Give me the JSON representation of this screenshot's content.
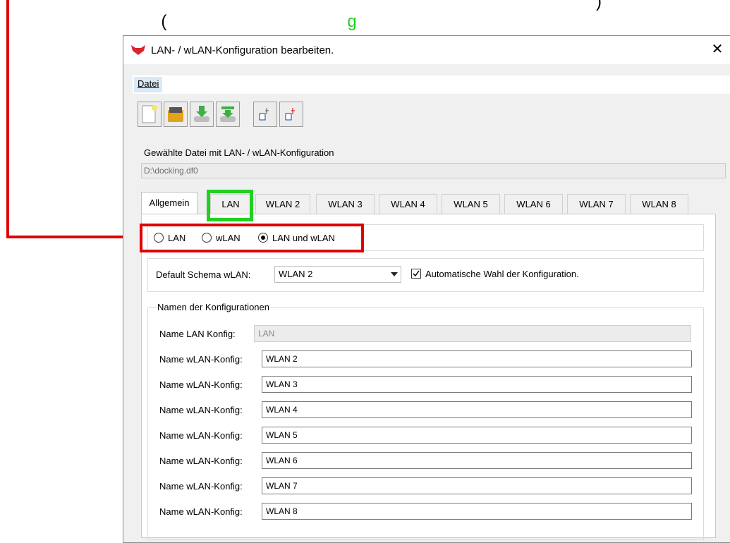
{
  "annotation": {
    "open_paren": "(",
    "green_fragment": "g",
    "close_paren": ")"
  },
  "window": {
    "title": "LAN- / wLAN-Konfiguration bearbeiten.",
    "close_symbol": "✕"
  },
  "menu": {
    "items": [
      {
        "label": "Datei"
      }
    ]
  },
  "toolbar": {
    "buttons": [
      "new-file-icon",
      "open-folder-icon",
      "import-icon",
      "export-icon",
      "device-link-icon",
      "device-send-icon"
    ]
  },
  "file_group": {
    "label": "Gewählte Datei mit LAN- / wLAN-Konfiguration",
    "value": "D:\\docking.df0"
  },
  "tabs": [
    {
      "label": "Allgemein",
      "active": true
    },
    {
      "label": "LAN"
    },
    {
      "label": "WLAN 2"
    },
    {
      "label": "WLAN 3"
    },
    {
      "label": "WLAN 4"
    },
    {
      "label": "WLAN 5"
    },
    {
      "label": "WLAN 6"
    },
    {
      "label": "WLAN 7"
    },
    {
      "label": "WLAN 8"
    }
  ],
  "mode": {
    "options": [
      "LAN",
      "wLAN",
      "LAN und wLAN"
    ],
    "selected": "LAN und wLAN"
  },
  "schema": {
    "label": "Default Schema wLAN:",
    "value": "WLAN 2",
    "auto_label": "Automatische Wahl der Konfiguration.",
    "auto_checked": true
  },
  "names": {
    "label": "Namen der Konfigurationen",
    "lan": {
      "label": "Name LAN Konfig:",
      "value": "LAN"
    },
    "wlan_label": "Name wLAN-Konfig:",
    "wlan_values": [
      "WLAN 2",
      "WLAN 3",
      "WLAN 4",
      "WLAN 5",
      "WLAN 6",
      "WLAN 7",
      "WLAN 8"
    ]
  },
  "colors": {
    "highlight_green": "#22d022",
    "highlight_red": "#e00000",
    "app_icon": "#d9262c"
  }
}
